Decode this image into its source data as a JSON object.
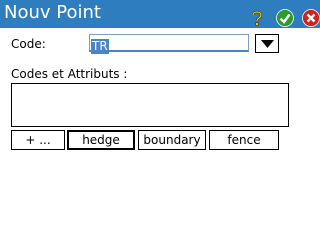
{
  "window": {
    "title": "Nouv Point"
  },
  "titlebar_icons": {
    "help": "help-icon",
    "ok": "ok-icon",
    "close": "close-icon"
  },
  "colors": {
    "titlebar": "#2e7dbf",
    "selection": "#4a85c8",
    "ok": "#2d9b2d",
    "close": "#d32020"
  },
  "form": {
    "code_label": "Code:",
    "code_value": "TR",
    "dropdown_icon": "triangle-down-icon",
    "attributes_label": "Codes et Attributs :"
  },
  "chips": [
    {
      "label": "+ ..."
    },
    {
      "label": "hedge"
    },
    {
      "label": "boundary"
    },
    {
      "label": "fence"
    }
  ]
}
